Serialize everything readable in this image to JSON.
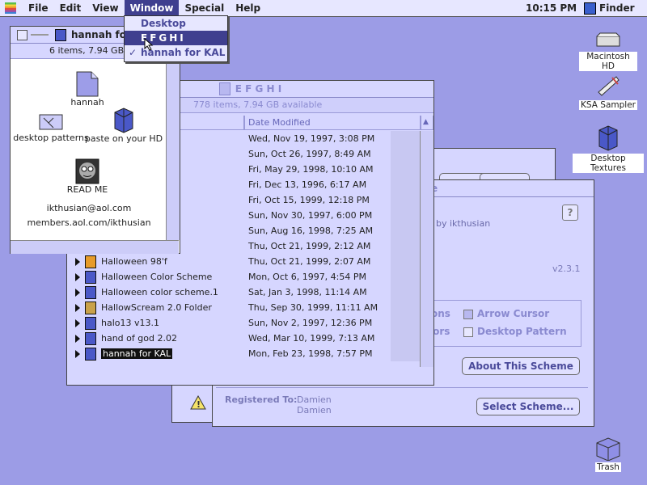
{
  "menubar": {
    "items": [
      "File",
      "Edit",
      "View",
      "Window",
      "Special",
      "Help"
    ],
    "clock": "10:15 PM",
    "app": "Finder"
  },
  "window_menu": {
    "items": [
      {
        "label": "Desktop",
        "checked": false
      },
      {
        "label": "EFGHI",
        "checked": false
      },
      {
        "label": "hannah for KAL",
        "checked": true
      }
    ]
  },
  "hannah_window": {
    "title": "hannah for",
    "info": "6 items, 7.94 GB a",
    "icons": [
      "hannah",
      "desktop patterns",
      "paste on your HD",
      "READ ME"
    ],
    "email": "ikthusian@aol.com",
    "url": "members.aol.com/ikthusian"
  },
  "efghi_window": {
    "title": "E F G H I",
    "info": "778 items, 7.94 GB available",
    "col_date": "Date Modified",
    "rows": [
      {
        "name": "",
        "date": "Wed, Nov 19, 1997, 3:08 PM",
        "icon": "blue"
      },
      {
        "name": "",
        "date": "Sun, Oct 26, 1997, 8:49 AM",
        "icon": "blue"
      },
      {
        "name": "",
        "date": "Fri, May 29, 1998, 10:10 AM",
        "icon": "blue"
      },
      {
        "name": "",
        "date": "Fri, Dec 13, 1996, 6:17 AM",
        "icon": "blue"
      },
      {
        "name": "",
        "date": "Fri, Oct 15, 1999, 12:18 PM",
        "icon": "blue"
      },
      {
        "name": "",
        "date": "Sun, Nov 30, 1997, 6:00 PM",
        "icon": "blue"
      },
      {
        "name": "",
        "date": "Sun, Aug 16, 1998, 7:25 AM",
        "icon": "blue"
      },
      {
        "name": "",
        "date": "Thu, Oct 21, 1999, 2:12 AM",
        "icon": "blue"
      },
      {
        "name": "Halloween 98'f",
        "date": "Thu, Oct 21, 1999, 2:07 AM",
        "icon": "orange"
      },
      {
        "name": "Halloween Color Scheme",
        "date": "Mon, Oct 6, 1997, 4:54 PM",
        "icon": "blue"
      },
      {
        "name": "Halloween color scheme.1",
        "date": "Sat, Jan 3, 1998, 11:14 AM",
        "icon": "blue"
      },
      {
        "name": "HallowScream 2.0 Folder",
        "date": "Thu, Sep 30, 1999, 11:11 AM",
        "icon": "folder"
      },
      {
        "name": "halo13 v13.1",
        "date": "Sun, Nov 2, 1997, 12:36 PM",
        "icon": "blue"
      },
      {
        "name": "hand of god 2.02",
        "date": "Wed, Mar 10, 1999, 7:13 AM",
        "icon": "blue"
      },
      {
        "name": "hannah for KAL",
        "date": "Mon, Feb 23, 1998, 7:57 PM",
        "icon": "blue",
        "selected": true
      }
    ]
  },
  "scheme_window": {
    "title": "e",
    "by": "by ikthusian",
    "version": "v2.3.1",
    "opt1": "ons",
    "opt2": "lors",
    "arrow_cursor": "Arrow Cursor",
    "desktop_pattern": "Desktop Pattern",
    "about_btn": "About This Scheme",
    "registered_label": "Registered To:",
    "registered_name1": "Damien",
    "registered_name2": "Damien",
    "select_btn": "Select Scheme..."
  },
  "desktop_icons": [
    "Macintosh HD",
    "KSA Sampler",
    "Desktop Textures",
    "Trash"
  ]
}
